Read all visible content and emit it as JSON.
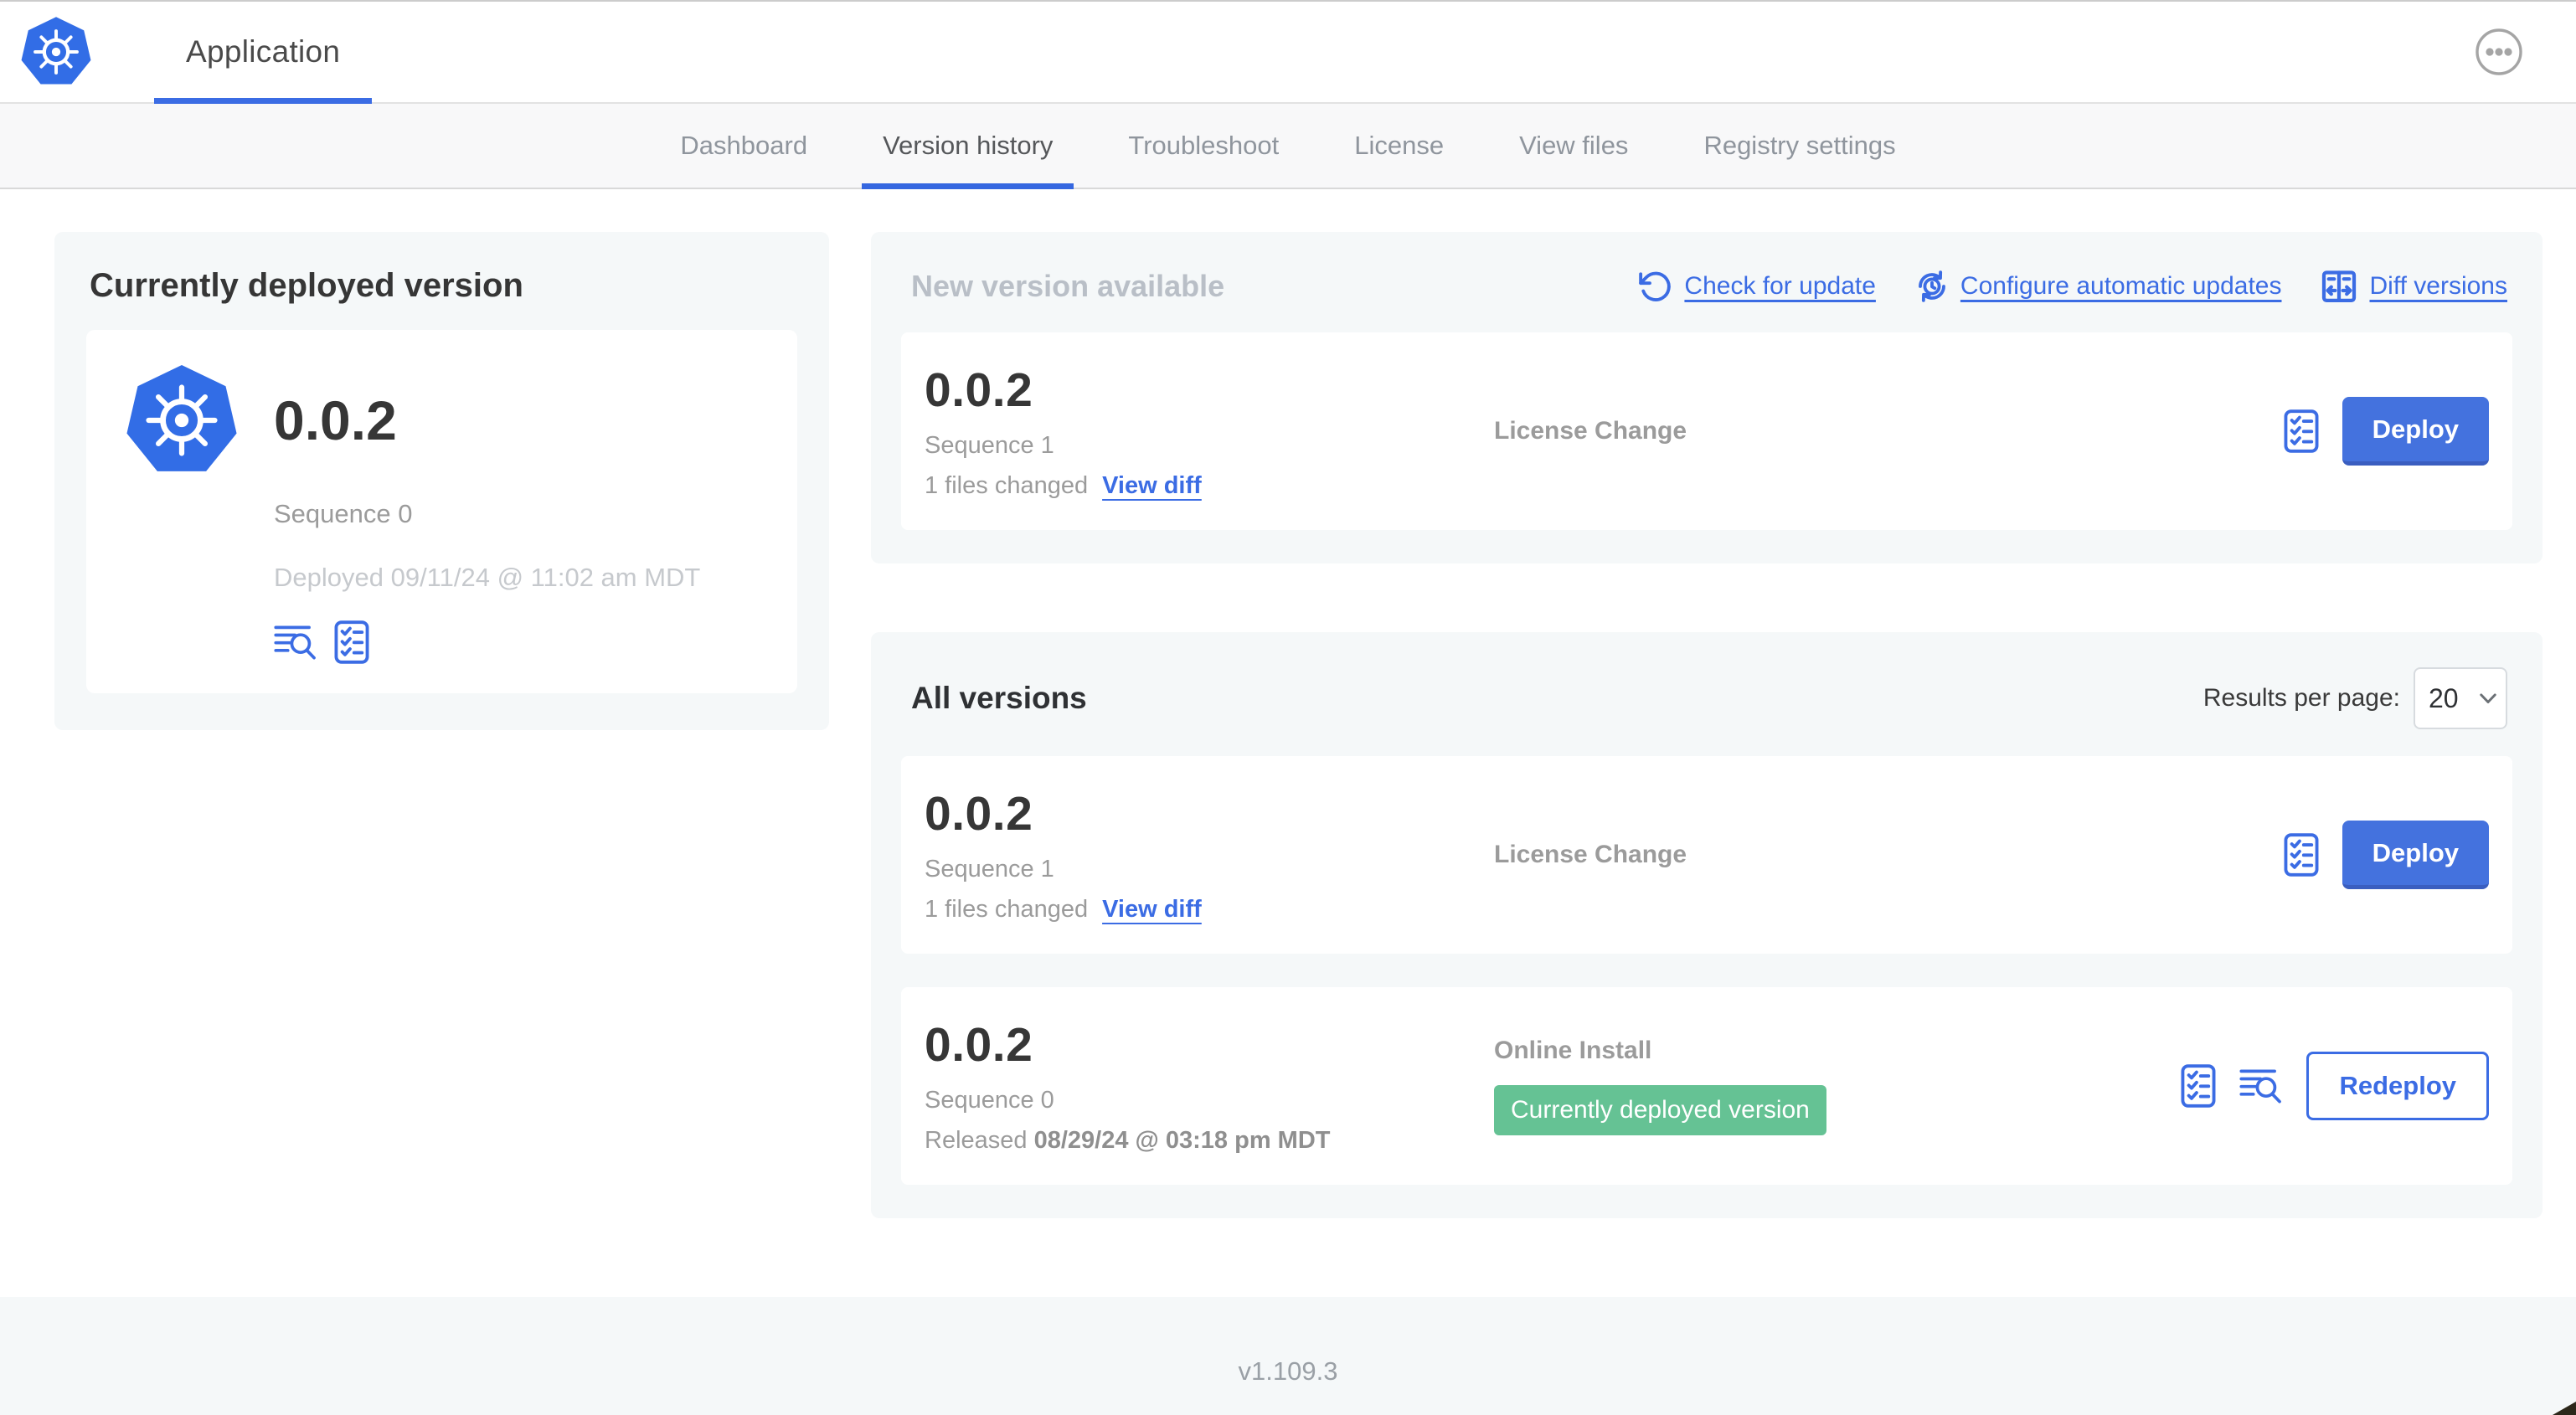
{
  "header": {
    "app_title": "Application",
    "logo_icon": "kubernetes-logo",
    "menu_icon": "ellipsis-icon"
  },
  "nav": {
    "tabs": [
      {
        "label": "Dashboard",
        "active": false
      },
      {
        "label": "Version history",
        "active": true
      },
      {
        "label": "Troubleshoot",
        "active": false
      },
      {
        "label": "License",
        "active": false
      },
      {
        "label": "View files",
        "active": false
      },
      {
        "label": "Registry settings",
        "active": false
      }
    ]
  },
  "current_version": {
    "panel_title": "Currently deployed version",
    "version": "0.0.2",
    "sequence": "Sequence 0",
    "deployed": "Deployed 09/11/24 @ 11:02 am MDT",
    "icons": [
      "view-logs-icon",
      "preflight-checklist-icon"
    ]
  },
  "new_version": {
    "panel_title": "New version available",
    "links": [
      {
        "label": "Check for update",
        "icon": "refresh-icon"
      },
      {
        "label": "Configure automatic updates",
        "icon": "clock-refresh-icon"
      },
      {
        "label": "Diff versions",
        "icon": "diff-icon"
      }
    ],
    "card": {
      "version": "0.0.2",
      "sequence": "Sequence 1",
      "files_changed": "1 files changed",
      "view_diff_label": "View diff",
      "source": "License Change",
      "action_label": "Deploy"
    }
  },
  "all_versions": {
    "panel_title": "All versions",
    "results_per_page_label": "Results per page:",
    "results_per_page_value": "20",
    "rows": [
      {
        "version": "0.0.2",
        "sequence": "Sequence 1",
        "files_changed": "1 files changed",
        "view_diff_label": "View diff",
        "source": "License Change",
        "action_label": "Deploy"
      },
      {
        "version": "0.0.2",
        "sequence": "Sequence 0",
        "released_label": "Released",
        "released_date": "08/29/24 @ 03:18 pm MDT",
        "source": "Online Install",
        "badge": "Currently deployed version",
        "action_label": "Redeploy"
      }
    ]
  },
  "footer": {
    "version": "v1.109.3"
  },
  "colors": {
    "accent_blue": "#3b6ce4",
    "brand_blue": "#326de6",
    "deploy_button_blue": "#4472de",
    "badge_green": "#65c294",
    "panel_gray": "#f5f8f9"
  }
}
